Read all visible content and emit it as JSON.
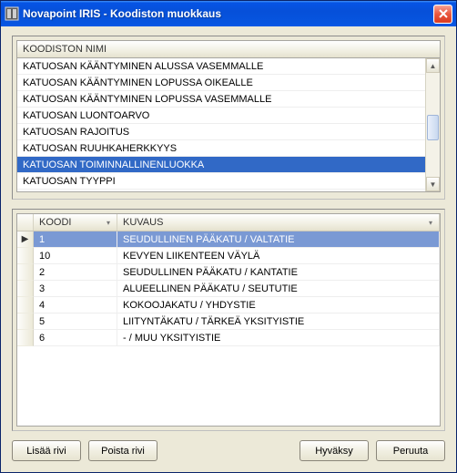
{
  "window": {
    "title": "Novapoint IRIS - Koodiston muokkaus"
  },
  "top_list": {
    "header": "KOODISTON NIMI",
    "rows": [
      {
        "label": "KATUOSAN KÄÄNTYMINEN ALUSSA VASEMMALLE",
        "selected": false
      },
      {
        "label": "KATUOSAN KÄÄNTYMINEN LOPUSSA OIKEALLE",
        "selected": false
      },
      {
        "label": "KATUOSAN KÄÄNTYMINEN LOPUSSA VASEMMALLE",
        "selected": false
      },
      {
        "label": "KATUOSAN LUONTOARVO",
        "selected": false
      },
      {
        "label": "KATUOSAN RAJOITUS",
        "selected": false
      },
      {
        "label": "KATUOSAN RUUHKAHERKKYYS",
        "selected": false
      },
      {
        "label": "KATUOSAN TOIMINNALLINENLUOKKA",
        "selected": true
      },
      {
        "label": "KATUOSAN TYYPPI",
        "selected": false
      }
    ]
  },
  "bottom_grid": {
    "columns": {
      "koodi": "KOODI",
      "kuvaus": "KUVAUS"
    },
    "rows": [
      {
        "koodi": "1",
        "kuvaus": "SEUDULLINEN PÄÄKATU / VALTATIE",
        "selected": true,
        "current": true
      },
      {
        "koodi": "10",
        "kuvaus": "KEVYEN LIIKENTEEN VÄYLÄ",
        "selected": false,
        "current": false
      },
      {
        "koodi": "2",
        "kuvaus": "SEUDULLINEN PÄÄKATU / KANTATIE",
        "selected": false,
        "current": false
      },
      {
        "koodi": "3",
        "kuvaus": "ALUEELLINEN PÄÄKATU / SEUTUTIE",
        "selected": false,
        "current": false
      },
      {
        "koodi": "4",
        "kuvaus": "KOKOOJAKATU / YHDYSTIE",
        "selected": false,
        "current": false
      },
      {
        "koodi": "5",
        "kuvaus": "LIITYNTÄKATU / TÄRKEÄ YKSITYISTIE",
        "selected": false,
        "current": false
      },
      {
        "koodi": "6",
        "kuvaus": " - / MUU YKSITYISTIE",
        "selected": false,
        "current": false
      }
    ]
  },
  "buttons": {
    "add_row": "Lisää rivi",
    "delete_row": "Poista rivi",
    "accept": "Hyväksy",
    "cancel": "Peruuta"
  }
}
